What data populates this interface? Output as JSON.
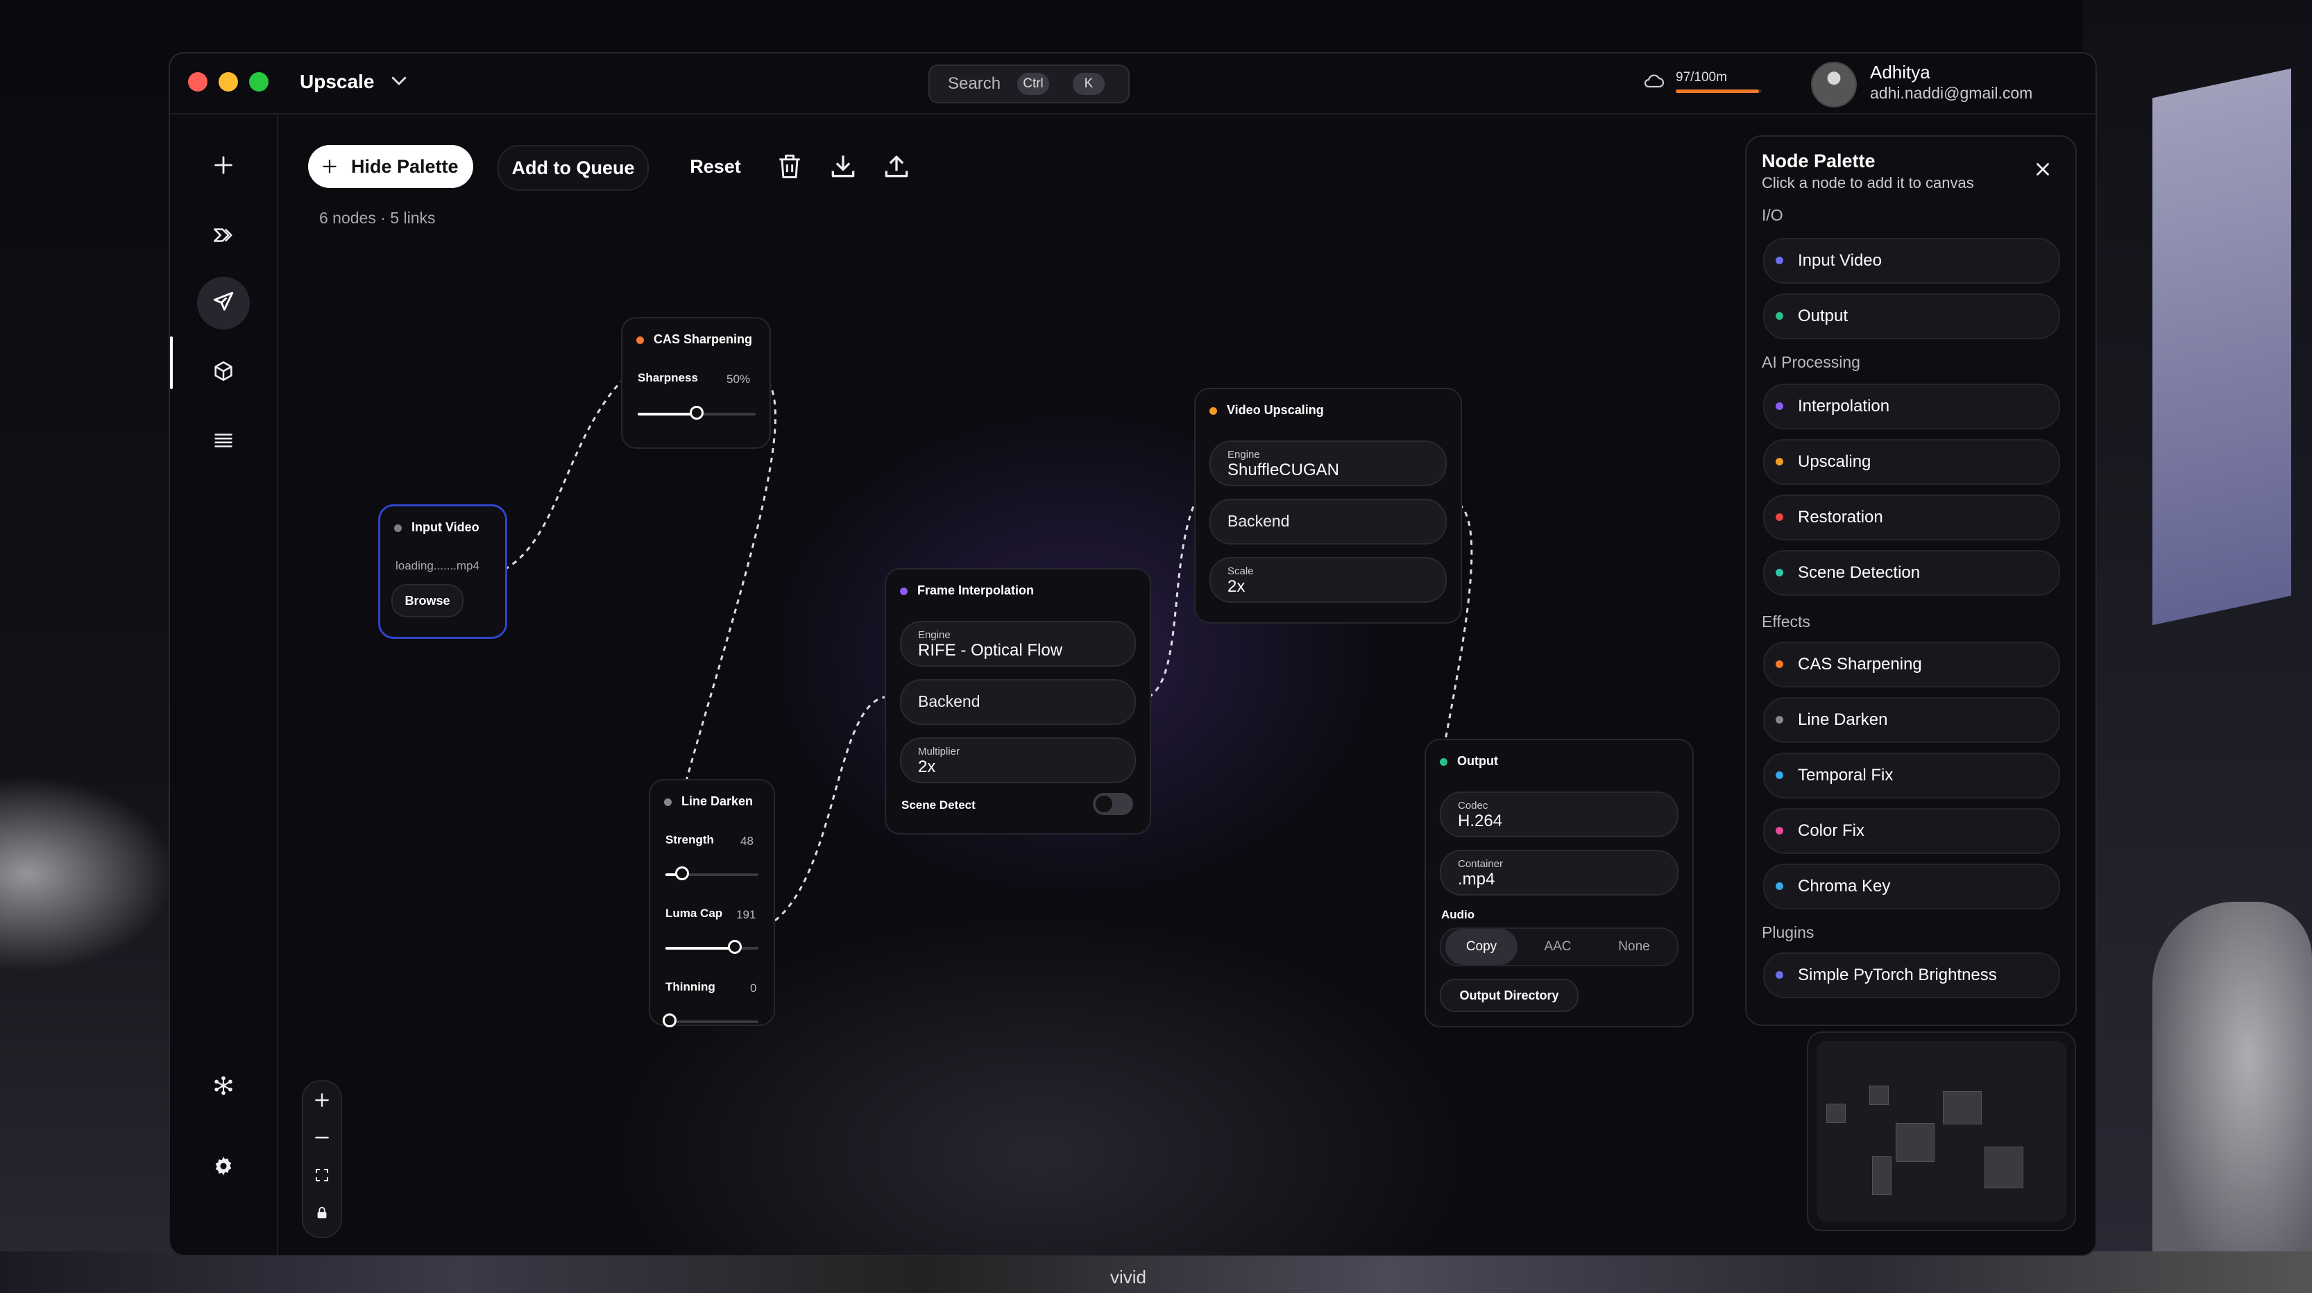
{
  "window": {
    "title": "Upscale"
  },
  "search": {
    "label": "Search",
    "key1": "Ctrl",
    "key2": "K"
  },
  "storage": {
    "text": "97/100m",
    "used_fraction": 0.97,
    "color": "#f07a2a"
  },
  "user": {
    "name": "Adhitya",
    "email": "adhi.naddi@gmail.com"
  },
  "toolbar": {
    "hide_palette": "Hide Palette",
    "add_to_queue": "Add to Queue",
    "reset": "Reset"
  },
  "stats": "6 nodes · 5 links",
  "colors": {
    "blue": "#6b6ee8",
    "green": "#2bbf8a",
    "purple": "#8b5cf6",
    "orange": "#f59a23",
    "red": "#ef4444",
    "teal": "#2cc8a8",
    "gray": "#888888",
    "sky": "#38a8e8",
    "pink": "#ec4899",
    "selected_border": "#2f45c9"
  },
  "nodes": {
    "input_video": {
      "title": "Input Video",
      "file": "loading.......mp4",
      "browse": "Browse"
    },
    "cas": {
      "title": "CAS Sharpening",
      "param": "Sharpness",
      "value": "50%",
      "level": 0.5
    },
    "line_darken": {
      "title": "Line Darken",
      "strength_label": "Strength",
      "strength_value": "48",
      "luma_label": "Luma Cap",
      "luma_value": "191",
      "thinning_label": "Thinning",
      "thinning_value": "0"
    },
    "interp": {
      "title": "Frame Interpolation",
      "engine_label": "Engine",
      "engine_value": "RIFE - Optical Flow",
      "backend": "Backend",
      "multiplier_label": "Multiplier",
      "multiplier_value": "2x",
      "scene_detect": "Scene Detect"
    },
    "upscale": {
      "title": "Video Upscaling",
      "engine_label": "Engine",
      "engine_value": "ShuffleCUGAN",
      "backend": "Backend",
      "scale_label": "Scale",
      "scale_value": "2x"
    },
    "output": {
      "title": "Output",
      "codec_label": "Codec",
      "codec_value": "H.264",
      "container_label": "Container",
      "container_value": ".mp4",
      "audio_label": "Audio",
      "audio_options": [
        "Copy",
        "AAC",
        "None"
      ],
      "audio_selected": "Copy",
      "output_dir": "Output Directory"
    }
  },
  "palette": {
    "title": "Node Palette",
    "subtitle": "Click a node to add it to canvas",
    "categories": {
      "io": "I/O",
      "ai": "AI Processing",
      "effects": "Effects",
      "plugins": "Plugins"
    },
    "items": {
      "input_video": "Input Video",
      "output": "Output",
      "interpolation": "Interpolation",
      "upscaling": "Upscaling",
      "restoration": "Restoration",
      "scene_detection": "Scene Detection",
      "cas": "CAS Sharpening",
      "line_darken": "Line Darken",
      "temporal_fix": "Temporal Fix",
      "color_fix": "Color Fix",
      "chroma_key": "Chroma Key",
      "pytorch": "Simple PyTorch Brightness"
    }
  },
  "background": {
    "caption": "vivid"
  }
}
